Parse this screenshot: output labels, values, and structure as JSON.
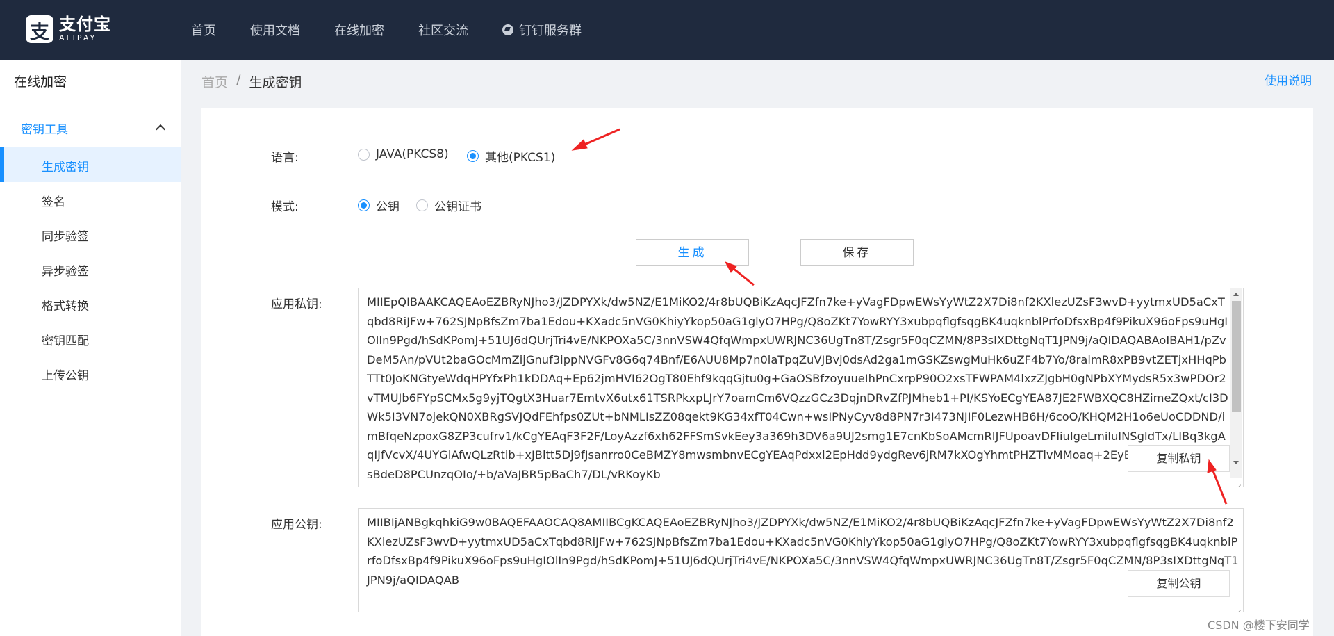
{
  "header": {
    "logo_cn": "支付宝",
    "logo_en": "ALIPAY",
    "logo_mark": "支",
    "nav": [
      "首页",
      "使用文档",
      "在线加密",
      "社区交流",
      "钉钉服务群"
    ]
  },
  "sidebar": {
    "title": "在线加密",
    "group_label": "密钥工具",
    "items": [
      "生成密钥",
      "签名",
      "同步验签",
      "异步验签",
      "格式转换",
      "密钥匹配",
      "上传公钥"
    ],
    "active_index": 0
  },
  "breadcrumb": {
    "home": "首页",
    "separator": "/",
    "current": "生成密钥"
  },
  "help_link": "使用说明",
  "form": {
    "language_label": "语言:",
    "language_options": [
      "JAVA(PKCS8)",
      "其他(PKCS1)"
    ],
    "language_selected": "其他(PKCS1)",
    "mode_label": "模式:",
    "mode_options": [
      "公钥",
      "公钥证书"
    ],
    "mode_selected": "公钥",
    "generate_label": "生成",
    "save_label": "保存",
    "private_key_label": "应用私钥:",
    "public_key_label": "应用公钥:",
    "copy_private_label": "复制私钥",
    "copy_public_label": "复制公钥",
    "private_key": "MIIEpQIBAAKCAQEAoEZBRyNJho3/JZDPYXk/dw5NZ/E1MiKO2/4r8bUQBiKzAqcJFZfn7ke+yVagFDpwEWsYyWtZ2X7Di8nf2KXlezUZsF3wvD+yytmxUD5aCxTqbd8RiJFw+762SJNpBfsZm7ba1Edou+KXadc5nVG0KhiyYkop50aG1glyO7HPg/Q8oZKt7YowRYY3xubpqflgfsqgBK4uqknblPrfoDfsxBp4f9PikuX96oFps9uHgIOlIn9Pgd/hSdKPomJ+51UJ6dQUrjTri4vE/NKPOXa5C/3nnVSW4QfqWmpxUWRJNC36UgTn8T/Zsgr5F0qCZMN/8P3sIXDttgNqT1JPN9j/aQIDAQABAoIBAH1/pZvDeM5An/pVUt2baGOcMmZijGnuf3ippNVGFv8G6q74Bnf/E6AUU8Mp7n0laTpqZuVJBvj0dsAd2ga1mGSKZswgMuHk6uZF4b7Yo/8ralmR8xPB9vtZETjxHHqPbTTt0JoKNGtyeWdqHPYfxPh1kDDAq+Ep62jmHVI62OgT80Ehf9kqqGjtu0g+GaOSBfzoyuueIhPnCxrpP90O2xsTFWPAM4lxzZJgbH0gNPbXYMydsR5x3wPDOr2vTMUJb6FYpSCMx5g9yjTQgtX3Huar7EmtvX6utx61TSRPkxpLJrY7oamCm6VQzzGCz3DqjnDRvZfPJMheb1+PI/KSYoECgYEA87JE2FWBXQC8HZimeZQxt/cI3DWk5I3VN7ojekQN0XBRgSVJQdFEhfps0ZUt+bNMLIsZZ08qekt9KG34xfT04Cwn+wsIPNyCyv8d8PN7r3I473NJIF0LezwHB6H/6coO/KHQM2H1o6eUoCDDND/imBfqeNzpoxG8ZP3cufrv1/kCgYEAqF3F2F/LoyAzzf6xh62FFSmSvkEey3a369h3DV6a9UJ2smg1E7cnKbSoAMcmRIJFUpoavDFliuIgeLmiluINSgIdTx/LIBq3kgAqIJfVcvX/4UYGlAfwQLzRtib+xJBltt5Dj9fJsanrro0CeBMZY8mwsmbnvECgYEAqPdxxl2EpHdd9ydgRev6jRM7kXOgYhmtPHZTlvMMoaq+2EyB/qCaYkrAKJDGz9sBdeD8PCUnzqOIo/+b/aVaJBR5pBaCh7/DL/vRKoyKb",
    "public_key": "MIIBIjANBgkqhkiG9w0BAQEFAAOCAQ8AMIIBCgKCAQEAoEZBRyNJho3/JZDPYXk/dw5NZ/E1MiKO2/4r8bUQBiKzAqcJFZfn7ke+yVagFDpwEWsYyWtZ2X7Di8nf2KXlezUZsF3wvD+yytmxUD5aCxTqbd8RiJFw+762SJNpBfsZm7ba1Edou+KXadc5nVG0KhiyYkop50aG1glyO7HPg/Q8oZKt7YowRYY3xubpqflgfsqgBK4uqknblPrfoDfsxBp4f9PikuX96oFps9uHgIOlIn9Pgd/hSdKPomJ+51UJ6dQUrjTri4vE/NKPOXa5C/3nnVSW4QfqWmpxUWRJNC36UgTn8T/Zsgr5F0qCZMN/8P3sIXDttgNqT1JPN9j/aQIDAQAB"
  },
  "watermark": "CSDN @楼下安同学",
  "colors": {
    "topbar": "#1f2a3e",
    "accent": "#1890ff",
    "annotation_arrow": "#ee2222"
  }
}
